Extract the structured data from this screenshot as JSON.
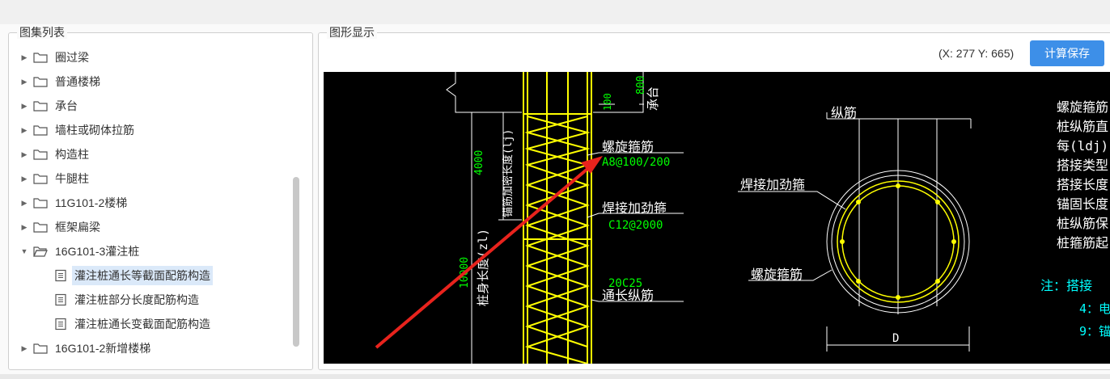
{
  "tree": {
    "legend": "图集列表",
    "items": [
      {
        "label": "圈过梁",
        "type": "folder",
        "expanded": false
      },
      {
        "label": "普通楼梯",
        "type": "folder",
        "expanded": false
      },
      {
        "label": "承台",
        "type": "folder",
        "expanded": false
      },
      {
        "label": "墙柱或砌体拉筋",
        "type": "folder",
        "expanded": false
      },
      {
        "label": "构造柱",
        "type": "folder",
        "expanded": false
      },
      {
        "label": "牛腿柱",
        "type": "folder",
        "expanded": false
      },
      {
        "label": "11G101-2楼梯",
        "type": "folder",
        "expanded": false
      },
      {
        "label": "框架扁梁",
        "type": "folder",
        "expanded": false
      },
      {
        "label": "16G101-3灌注桩",
        "type": "folder",
        "expanded": true
      },
      {
        "label": "灌注桩通长等截面配筋构造",
        "type": "doc",
        "selected": true
      },
      {
        "label": "灌注桩部分长度配筋构造",
        "type": "doc"
      },
      {
        "label": "灌注桩通长变截面配筋构造",
        "type": "doc"
      },
      {
        "label": "16G101-2新增楼梯",
        "type": "folder",
        "expanded": false
      }
    ]
  },
  "graphic": {
    "legend": "图形显示",
    "coords": "(X: 277 Y: 665)",
    "calc_button": "计算保存"
  },
  "drawing": {
    "dim_800": "800",
    "cap_label": "承台",
    "dim_100": "100",
    "dim_4000": "4000",
    "anchor_label": "锚筋加密长度(lj)",
    "dim_10000": "10000",
    "pile_length_label": "桩身长度(zl)",
    "spiral_label": "螺旋箍筋",
    "spiral_value": "A8@100/200",
    "weld_label": "焊接加劲箍",
    "weld_value": "C12@2000",
    "long_value": "20C25",
    "long_label": "通长纵筋",
    "section_long_label": "纵筋",
    "section_weld_label": "焊接加劲箍",
    "section_spiral_label": "螺旋箍筋",
    "diameter_label": "D",
    "notes": [
      "螺旋箍筋",
      "桩纵筋直",
      "每(ldj)",
      "搭接类型",
      "搭接长度",
      "锚固长度",
      "桩纵筋保",
      "桩箍筋起"
    ],
    "note_prefix": "注：搭接",
    "note_4": "4：电",
    "note_9": "9：锚",
    "colors": {
      "white": "#ffffff",
      "yellow": "#ffff00",
      "green": "#00ff00",
      "cyan": "#00ffff",
      "arrow": "#e8231d"
    }
  }
}
